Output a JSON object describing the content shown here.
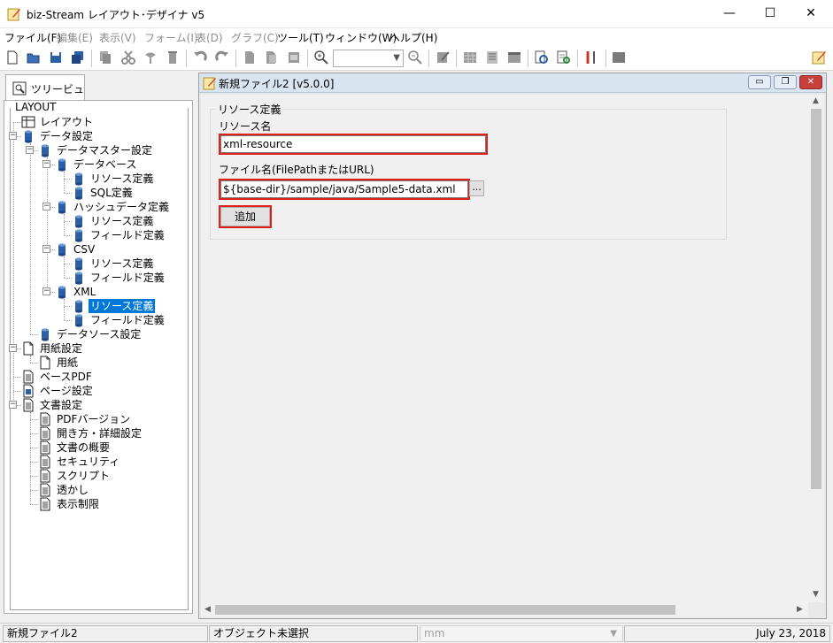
{
  "window": {
    "title": "biz-Stream レイアウト･デザイナ v5",
    "minimize": "—",
    "maximize": "☐",
    "close": "✕"
  },
  "menu": [
    {
      "label": "ファイル(F)",
      "enabled": true
    },
    {
      "label": "編集(E)",
      "enabled": false
    },
    {
      "label": "表示(V)",
      "enabled": false
    },
    {
      "label": "フォーム(I)",
      "enabled": false
    },
    {
      "label": "表(D)",
      "enabled": false
    },
    {
      "label": "グラフ(C)",
      "enabled": false
    },
    {
      "label": "ツール(T)",
      "enabled": true
    },
    {
      "label": "ウィンドウ(W)",
      "enabled": true
    },
    {
      "label": "ヘルプ(H)",
      "enabled": true
    }
  ],
  "tree_tab": {
    "label": "ツリービュー"
  },
  "tree": {
    "legend": "LAYOUT",
    "nodes": [
      {
        "label": "レイアウト",
        "icon": "layout-icon"
      },
      {
        "label": "データ設定",
        "icon": "database-icon"
      },
      {
        "label": "データマスター設定",
        "icon": "database-icon"
      },
      {
        "label": "データベース",
        "icon": "database-icon"
      },
      {
        "label": "リソース定義",
        "icon": "database-icon"
      },
      {
        "label": "SQL定義",
        "icon": "database-icon"
      },
      {
        "label": "ハッシュデータ定義",
        "icon": "database-icon"
      },
      {
        "label": "リソース定義",
        "icon": "database-icon"
      },
      {
        "label": "フィールド定義",
        "icon": "database-icon"
      },
      {
        "label": "CSV",
        "icon": "database-icon"
      },
      {
        "label": "リソース定義",
        "icon": "database-icon"
      },
      {
        "label": "フィールド定義",
        "icon": "database-icon"
      },
      {
        "label": "XML",
        "icon": "database-icon"
      },
      {
        "label": "リソース定義",
        "icon": "database-icon",
        "selected": true
      },
      {
        "label": "フィールド定義",
        "icon": "database-icon"
      },
      {
        "label": "データソース設定",
        "icon": "database-icon"
      },
      {
        "label": "用紙設定",
        "icon": "paper-icon"
      },
      {
        "label": "用紙",
        "icon": "paper-icon"
      },
      {
        "label": "ベースPDF",
        "icon": "document-icon"
      },
      {
        "label": "ページ設定",
        "icon": "page-settings-icon"
      },
      {
        "label": "文書設定",
        "icon": "document-icon"
      },
      {
        "label": "PDFバージョン",
        "icon": "document-icon"
      },
      {
        "label": "開き方・詳細設定",
        "icon": "document-icon"
      },
      {
        "label": "文書の概要",
        "icon": "document-icon"
      },
      {
        "label": "セキュリティ",
        "icon": "document-icon"
      },
      {
        "label": "スクリプト",
        "icon": "document-icon"
      },
      {
        "label": "透かし",
        "icon": "document-icon"
      },
      {
        "label": "表示制限",
        "icon": "document-icon"
      }
    ]
  },
  "child_window": {
    "title": "新規ファイル2 [v5.0.0]"
  },
  "form": {
    "group_title": "リソース定義",
    "resource_name_label": "リソース名",
    "resource_name_value": "xml-resource",
    "file_name_label": "ファイル名(FilePathまたはURL)",
    "file_name_value": "${base-dir}/sample/java/Sample5-data.xml",
    "browse_label": "...",
    "add_label": "追加"
  },
  "status": {
    "file": "新規ファイル2",
    "object": "オブジェクト未選択",
    "unit": "mm",
    "date": "July 23, 2018"
  },
  "colors": {
    "highlight": "#e0201b",
    "selection": "#0078d7"
  }
}
